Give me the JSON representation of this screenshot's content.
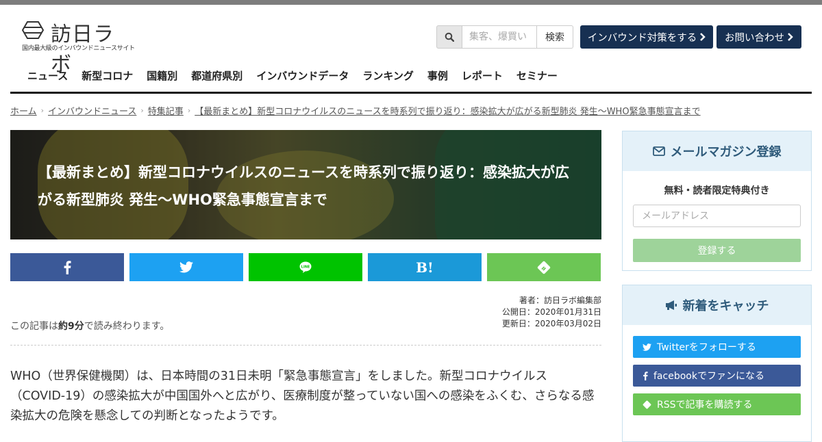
{
  "header": {
    "logo_text": "訪日ラボ",
    "logo_tagline": "国内最大級のインバウンドニュースサイト",
    "search_placeholder": "集客、爆買い",
    "search_button": "検索",
    "cta_primary": "インバウンド対策をする",
    "cta_contact": "お問い合わせ"
  },
  "nav": [
    "ニュース",
    "新型コロナ",
    "国籍別",
    "都道府県別",
    "インバウンドデータ",
    "ランキング",
    "事例",
    "レポート",
    "セミナー"
  ],
  "breadcrumb": {
    "home": "ホーム",
    "level1": "インバウンドニュース",
    "level2": "特集記事",
    "current": "【最新まとめ】新型コロナウイルスのニュースを時系列で振り返り：感染拡大が広がる新型肺炎 発生〜WHO緊急事態宣言まで"
  },
  "article": {
    "title": "【最新まとめ】新型コロナウイルスのニュースを時系列で振り返り：感染拡大が広がる新型肺炎 発生〜WHO緊急事態宣言まで",
    "author": "著者：訪日ラボ編集部",
    "published": "公開日：2020年01月31日",
    "updated": "更新日：2020年03月02日",
    "read_prefix": "この記事は",
    "read_time": "約9分",
    "read_suffix": "で読み終わります。",
    "body": "WHO（世界保健機関）は、日本時間の31日未明「緊急事態宣言」をしました。新型コロナウイルス（COVID-19）の感染拡大が中国国外へと広がり、医療制度が整っていない国への感染をふくむ、さらなる感染拡大の危険を懸念しての判断となったようです。"
  },
  "share": {
    "facebook": "f",
    "twitter": "twitter",
    "line": "LINE",
    "hatena": "B!",
    "feedly": "feedly",
    "colors": {
      "facebook": "#3b5998",
      "twitter": "#1da1f2",
      "line": "#00c300",
      "hatena": "#1b99d8",
      "feedly": "#6cc655"
    }
  },
  "sidebar": {
    "mail_title": "メールマガジン登録",
    "mail_sub": "無料・読者限定特典付き",
    "mail_placeholder": "メールアドレス",
    "mail_button": "登録する",
    "catch_title": "新着をキャッチ",
    "twitter_follow": "Twitterをフォローする",
    "facebook_follow": "facebookでファンになる",
    "rss_follow": "RSSで記事を購読する"
  }
}
